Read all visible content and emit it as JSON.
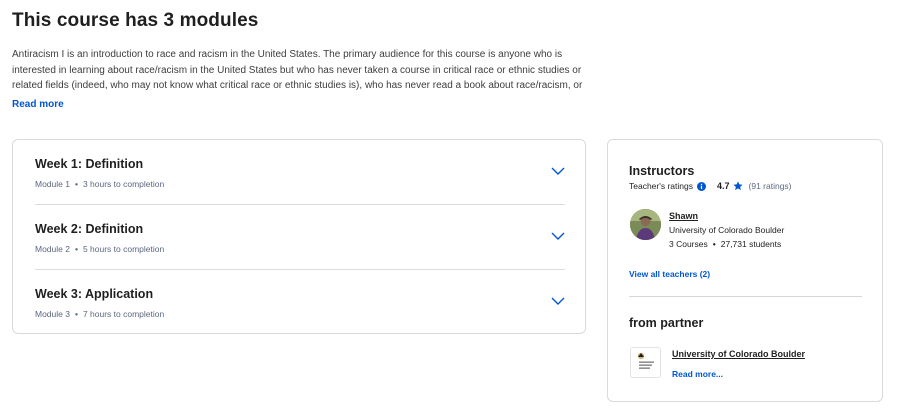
{
  "page": {
    "title": "This course has 3 modules",
    "description": "Antiracism I is an introduction to race and racism in the United States. The primary audience for this course is anyone who is interested in learning about race/racism in the United States but who has never taken a course in critical race or ethnic studies or related fields (indeed, who may not know what critical race or ethnic studies is), who has never read a book about race/racism, or who has not",
    "read_more": "Read more"
  },
  "modules": [
    {
      "title": "Week 1: Definition",
      "module": "Module 1",
      "duration": "3 hours to completion"
    },
    {
      "title": "Week 2: Definition",
      "module": "Module 2",
      "duration": "5 hours to completion"
    },
    {
      "title": "Week 3: Application",
      "module": "Module 3",
      "duration": "7 hours to completion"
    }
  ],
  "instructors": {
    "heading": "Instructors",
    "ratings_label": "Teacher's ratings",
    "rating": "4.7",
    "rating_count": "(91 ratings)",
    "instructor": {
      "name": "Shawn",
      "org": "University of Colorado Boulder",
      "courses": "3 Courses",
      "students": "27,731 students"
    },
    "view_all": "View all teachers (2)"
  },
  "partner": {
    "heading": "from partner",
    "name": "University of Colorado Boulder",
    "logo_text": "University of Colorado Boulder",
    "read_more": "Read more..."
  },
  "colors": {
    "accent": "#0056d2",
    "border": "#dadada",
    "muted_text": "#5b6780"
  },
  "icons": {
    "chevron": "chevron-down-icon",
    "info": "info-icon",
    "star": "star-icon"
  }
}
